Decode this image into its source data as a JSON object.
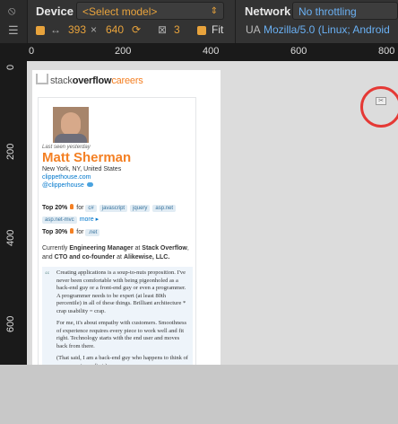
{
  "toolbar": {
    "device_label": "Device",
    "device_select": "<Select model>",
    "network_label": "Network",
    "network_select": "No throttling",
    "width": "393",
    "height": "640",
    "zoom": "3",
    "fit_label": "Fit",
    "ua_label": "UA",
    "ua_value": "Mozilla/5.0 (Linux; Android"
  },
  "ruler": {
    "top_ticks": [
      "0",
      "200",
      "400",
      "600",
      "800"
    ],
    "left_ticks": [
      "0",
      "200",
      "400",
      "600"
    ]
  },
  "page": {
    "logo_stack": "stack",
    "logo_overflow": "overflow",
    "logo_careers": "careers",
    "last_seen": "Last seen yesterday",
    "name": "Matt Sherman",
    "location": "New York, NY, United States",
    "website": "clippethouse.com",
    "twitter": "@clipperhouse",
    "top20_label": "Top 20%",
    "for_label": "for",
    "top20_tags": [
      "c#",
      "javascript",
      "jquery",
      "asp.net",
      "asp.net-mvc"
    ],
    "more_label": "more",
    "top30_label": "Top 30%",
    "top30_tags": [
      ".net"
    ],
    "bio_prefix": "Currently",
    "bio_role": "Engineering Manager",
    "bio_at": "at",
    "bio_company": "Stack Overflow",
    "bio_and": ", and",
    "bio_role2": "CTO and co-founder",
    "bio_company2": "Alikewise, LLC.",
    "quote_p1": "Creating applications is a soup-to-nuts proposition. I've never been comfortable with being pigeonholed as a back-end guy or a front-end guy or even a programmer. A programmer needs to be expert (at least 80th percentile) in all of these things. Brilliant architecture * crap usability = crap.",
    "quote_p2": "For me, it's about empathy with customers. Smoothness of experience requires every piece to work well and fit right. Technology starts with the end user and moves back from there.",
    "quote_p3": "(That said, I am a back-end guy who happens to think of user experience first.)"
  },
  "colors": {
    "accent_orange": "#e8a33c",
    "link_blue": "#6ab0f3",
    "annotation_red": "#e53935"
  }
}
